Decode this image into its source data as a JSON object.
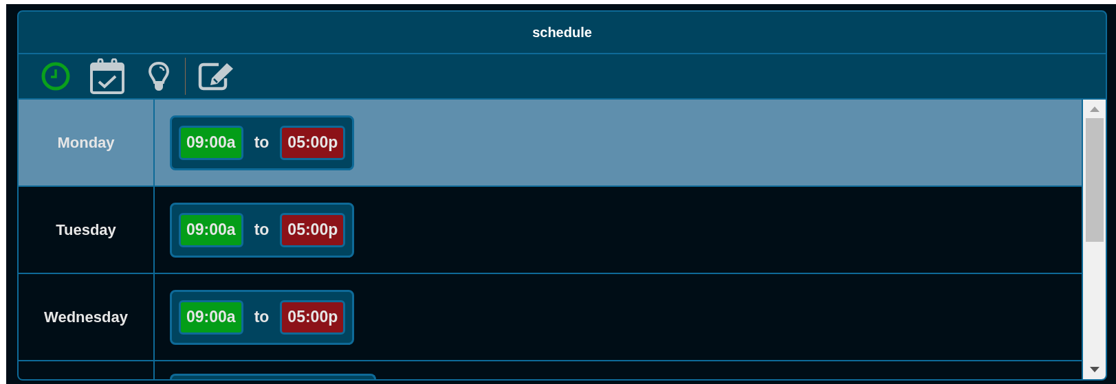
{
  "panel": {
    "title": "schedule"
  },
  "toolbar": [
    {
      "kind": "clock",
      "selected": true
    },
    {
      "kind": "calendar",
      "selected": false
    },
    {
      "kind": "bulb",
      "selected": false
    },
    {
      "kind": "separator"
    },
    {
      "kind": "edit",
      "selected": false
    }
  ],
  "rows": [
    {
      "day": "Monday",
      "selected": true,
      "start": "09:00a",
      "joiner": "to",
      "end": "05:00p"
    },
    {
      "day": "Tuesday",
      "selected": false,
      "start": "09:00a",
      "joiner": "to",
      "end": "05:00p"
    },
    {
      "day": "Wednesday",
      "selected": false,
      "start": "09:00a",
      "joiner": "to",
      "end": "05:00p"
    }
  ]
}
